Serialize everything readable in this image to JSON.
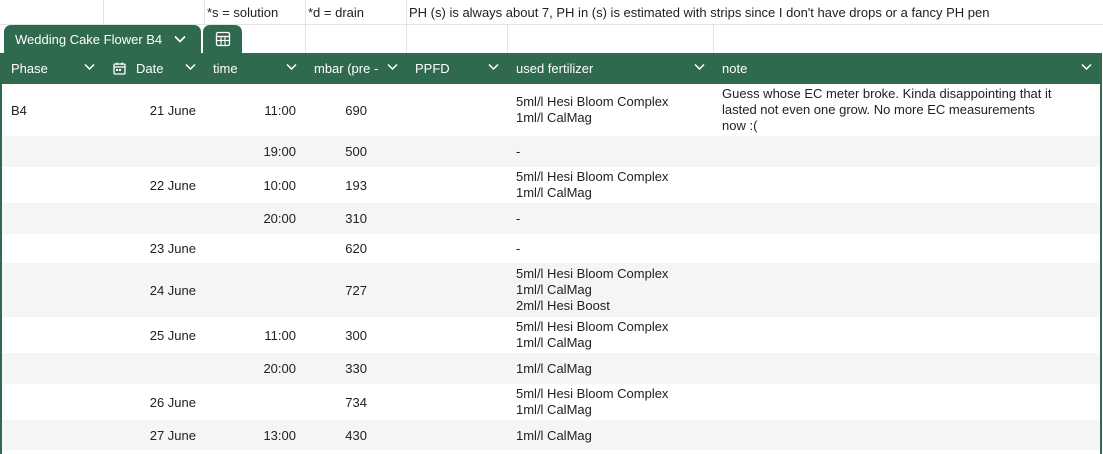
{
  "notes": {
    "solution": "*s = solution",
    "drain": "*d = drain",
    "ph_note": "PH (s) is always about 7, PH in (s) is estimated with strips since I don't have drops or a fancy PH pen"
  },
  "table": {
    "name": "Wedding Cake Flower B4"
  },
  "colors": {
    "header_bg": "#2f6a4f",
    "alt_row_bg": "#f4f5f5"
  },
  "columns": [
    {
      "label": "Phase"
    },
    {
      "label": "Date"
    },
    {
      "label": "time"
    },
    {
      "label": "mbar (pre -"
    },
    {
      "label": "PPFD"
    },
    {
      "label": "used fertilizer"
    },
    {
      "label": "note"
    }
  ],
  "rows": [
    {
      "phase": "B4",
      "date": "21 June",
      "time": "11:00",
      "mbar": "690",
      "fertilizer": [
        "5ml/l Hesi Bloom Complex",
        "1ml/l CalMag"
      ],
      "note": [
        "Guess whose EC meter broke. Kinda disappointing that it",
        "lasted not even one grow. No more EC measurements",
        "now :("
      ]
    },
    {
      "phase": "",
      "date": "",
      "time": "19:00",
      "mbar": "500",
      "fertilizer": [
        "-"
      ],
      "note": []
    },
    {
      "phase": "",
      "date": "22 June",
      "time": "10:00",
      "mbar": "193",
      "fertilizer": [
        "5ml/l Hesi Bloom Complex",
        "1ml/l CalMag"
      ],
      "note": []
    },
    {
      "phase": "",
      "date": "",
      "time": "20:00",
      "mbar": "310",
      "fertilizer": [
        "-"
      ],
      "note": []
    },
    {
      "phase": "",
      "date": "23 June",
      "time": "",
      "mbar": "620",
      "fertilizer": [
        "-"
      ],
      "note": []
    },
    {
      "phase": "",
      "date": "24 June",
      "time": "",
      "mbar": "727",
      "fertilizer": [
        "5ml/l Hesi Bloom Complex",
        "1ml/l CalMag",
        "2ml/l Hesi Boost"
      ],
      "note": []
    },
    {
      "phase": "",
      "date": "25 June",
      "time": "11:00",
      "mbar": "300",
      "fertilizer": [
        "5ml/l Hesi Bloom Complex",
        "1ml/l CalMag"
      ],
      "note": []
    },
    {
      "phase": "",
      "date": "",
      "time": "20:00",
      "mbar": "330",
      "fertilizer": [
        "1ml/l CalMag"
      ],
      "note": []
    },
    {
      "phase": "",
      "date": "26 June",
      "time": "",
      "mbar": "734",
      "fertilizer": [
        "5ml/l Hesi Bloom Complex",
        "1ml/l CalMag"
      ],
      "note": []
    },
    {
      "phase": "",
      "date": "27 June",
      "time": "13:00",
      "mbar": "430",
      "fertilizer": [
        "1ml/l CalMag"
      ],
      "note": []
    }
  ]
}
